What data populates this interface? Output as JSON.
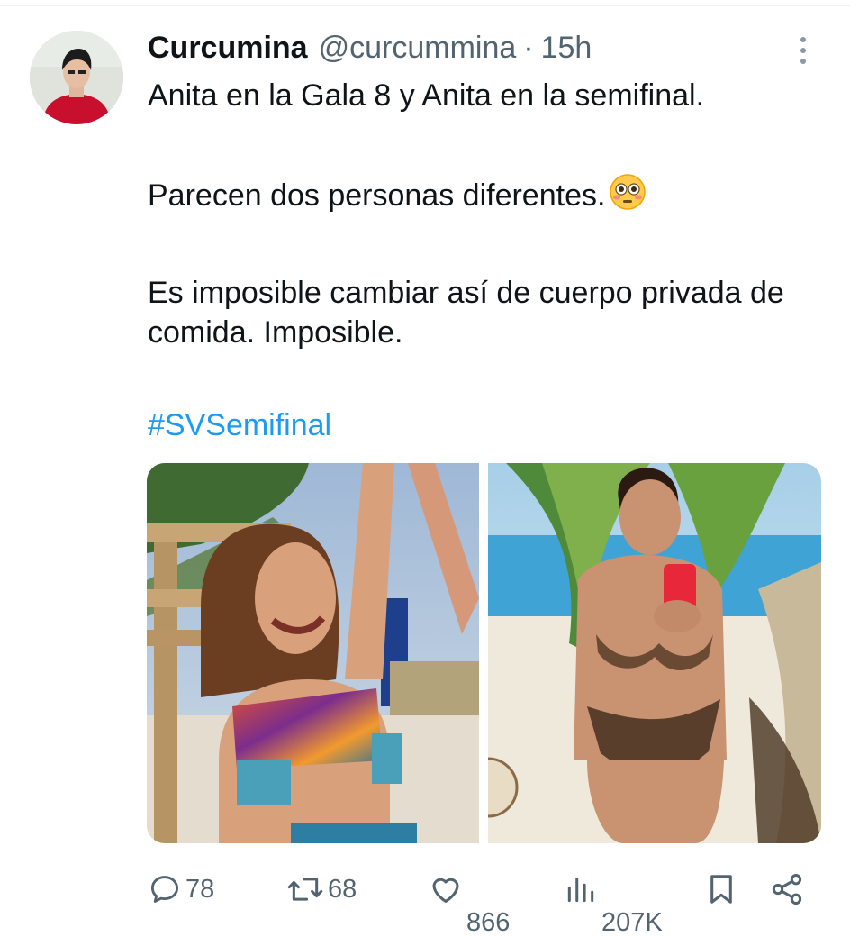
{
  "tweet": {
    "author": {
      "display_name": "Curcumina",
      "handle": "@curcummina",
      "separator": "·",
      "time": "15h"
    },
    "text_lines": [
      "Anita en la Gala 8 y Anita en la semifinal.",
      "Parecen dos personas diferentes.",
      "Es imposible cambiar así de cuerpo privada de comida. Imposible."
    ],
    "emoji": "flushed-face",
    "hashtag": "#SVSemifinal",
    "media": [
      {
        "name": "photo-gala-8",
        "icon": "photo"
      },
      {
        "name": "photo-semifinal",
        "icon": "photo"
      }
    ]
  },
  "actions": {
    "replies": "78",
    "reposts": "68",
    "likes_cut": "866",
    "views_cut": "207K"
  },
  "colors": {
    "text": "#0f1419",
    "secondary": "#536471",
    "link": "#1d9bf0",
    "background": "#ffffff"
  },
  "icons": [
    "more-vertical-icon",
    "reply-icon",
    "retweet-icon",
    "heart-icon",
    "views-icon",
    "bookmark-icon",
    "share-icon"
  ]
}
